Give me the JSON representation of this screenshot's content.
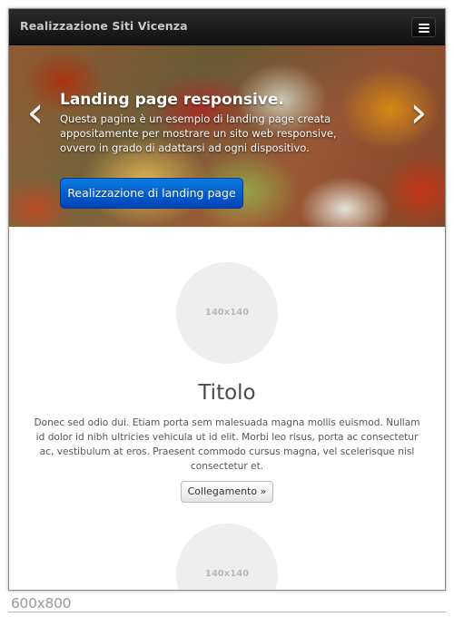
{
  "navbar": {
    "brand": "Realizzazione Siti Vicenza",
    "toggle_icon": "hamburger-menu-icon"
  },
  "hero": {
    "prev_arrow": "‹",
    "next_arrow": "›",
    "title": "Landing page responsive.",
    "text": "Questa pagina è un esempio di landing page creata appositamente per mostrare un sito web responsive, ovvero in grado di adattarsi ad ogni dispositivo.",
    "button_label": "Realizzazione di landing page",
    "button_color": "#0a6fd8"
  },
  "features": [
    {
      "image_placeholder": "140x140",
      "title": "Titolo",
      "text": "Donec sed odio dui. Etiam porta sem malesuada magna mollis euismod. Nullam id dolor id nibh ultricies vehicula ut id elit. Morbi leo risus, porta ac consectetur ac, vestibulum at eros. Praesent commodo cursus magna, vel scelerisque nisl consectetur et.",
      "button_label": "Collegamento »"
    },
    {
      "image_placeholder": "140x140"
    }
  ],
  "caption": "600x800"
}
